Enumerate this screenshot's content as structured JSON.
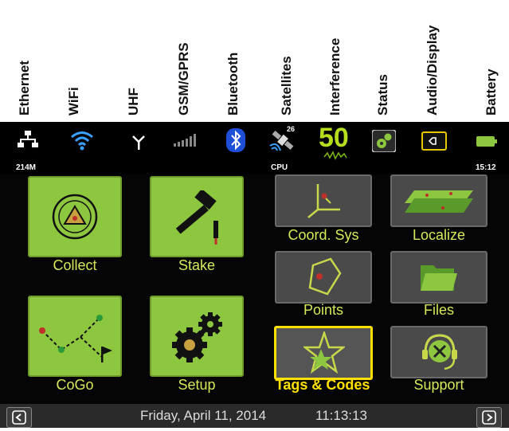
{
  "header_labels": [
    "Ethernet",
    "WiFi",
    "UHF",
    "GSM/GPRS",
    "Bluetooth",
    "Satellites",
    "Interference",
    "Status",
    "Audio/Display",
    "Battery"
  ],
  "status": {
    "data_amount": "214M",
    "satellite_count": "26",
    "cpu_label": "CPU",
    "interference_value": "50",
    "time": "15:12"
  },
  "tiles": {
    "collect": "Collect",
    "stake": "Stake",
    "cogo": "CoGo",
    "setup": "Setup",
    "coord_sys": "Coord. Sys",
    "localize": "Localize",
    "points": "Points",
    "files": "Files",
    "tags_codes": "Tags & Codes",
    "support": "Support"
  },
  "footer": {
    "date": "Friday, April 11, 2014",
    "clock": "11:13:13"
  },
  "colors": {
    "tile_green": "#8dc63f",
    "label_yellow_green": "#d8e85a",
    "selected_yellow": "#ffe000"
  }
}
